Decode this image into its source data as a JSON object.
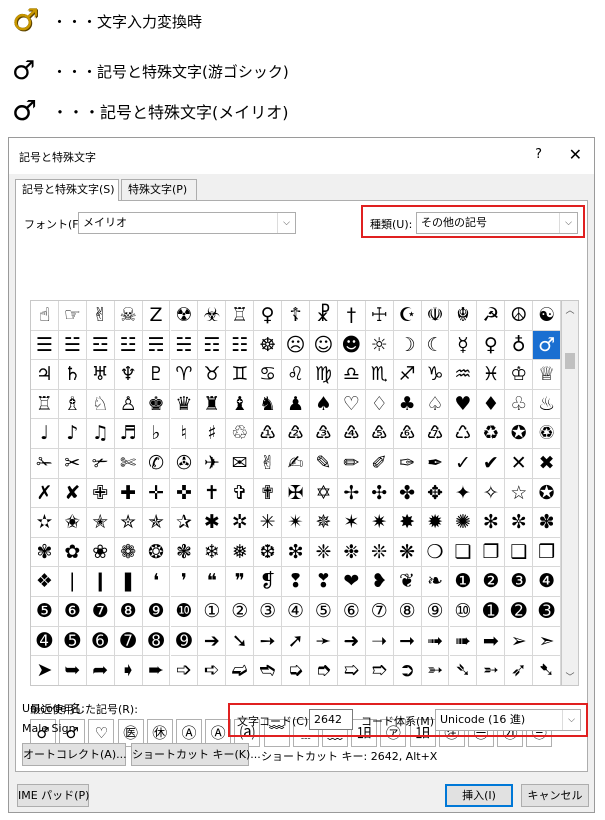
{
  "legend": [
    {
      "symbol": "♂",
      "text": "・・・文字入力変換時"
    },
    {
      "symbol": "♂",
      "text": "・・・記号と特殊文字(游ゴシック)"
    },
    {
      "symbol": "♂",
      "text": "・・・記号と特殊文字(メイリオ)"
    }
  ],
  "dialog": {
    "title": "記号と特殊文字",
    "help": "?",
    "close": "✕",
    "tabs": [
      "記号と特殊文字(S)",
      "特殊文字(P)"
    ],
    "font_label": "フォント(F):",
    "font_value": "メイリオ",
    "kind_label": "種類(U):",
    "kind_value": "その他の記号",
    "symbols": [
      [
        "☝",
        "☞",
        "✌",
        "☠",
        "Z",
        "☢",
        "☣",
        "♖",
        "♀",
        "☦",
        "☧",
        "†",
        "☩",
        "☪",
        "☫",
        "☬",
        "☭",
        "☮",
        "☯"
      ],
      [
        "☰",
        "☱",
        "☲",
        "☳",
        "☴",
        "☵",
        "☶",
        "☷",
        "☸",
        "☹",
        "☺",
        "☻",
        "☼",
        "☽",
        "☾",
        "☿",
        "♀",
        "♁",
        "♂"
      ],
      [
        "♃",
        "♄",
        "♅",
        "♆",
        "♇",
        "♈",
        "♉",
        "♊",
        "♋",
        "♌",
        "♍",
        "♎",
        "♏",
        "♐",
        "♑",
        "♒",
        "♓",
        "♔",
        "♕"
      ],
      [
        "♖",
        "♗",
        "♘",
        "♙",
        "♚",
        "♛",
        "♜",
        "♝",
        "♞",
        "♟",
        "♠",
        "♡",
        "♢",
        "♣",
        "♤",
        "♥",
        "♦",
        "♧",
        "♨"
      ],
      [
        "♩",
        "♪",
        "♫",
        "♬",
        "♭",
        "♮",
        "♯",
        "♲",
        "♳",
        "♴",
        "♵",
        "♶",
        "♷",
        "♸",
        "♹",
        "♺",
        "♻",
        "✪",
        "♽"
      ],
      [
        "✁",
        "✂",
        "✃",
        "✄",
        "✆",
        "✇",
        "✈",
        "✉",
        "✌",
        "✍",
        "✎",
        "✏",
        "✐",
        "✑",
        "✒",
        "✓",
        "✔",
        "✕",
        "✖"
      ],
      [
        "✗",
        "✘",
        "✙",
        "✚",
        "✛",
        "✜",
        "✝",
        "✞",
        "✟",
        "✠",
        "✡",
        "✢",
        "✣",
        "✤",
        "✥",
        "✦",
        "✧",
        "☆",
        "✪"
      ],
      [
        "✫",
        "✬",
        "✭",
        "✮",
        "✯",
        "✰",
        "✱",
        "✲",
        "✳",
        "✴",
        "✵",
        "✶",
        "✷",
        "✸",
        "✹",
        "✺",
        "✻",
        "✼",
        "✽"
      ],
      [
        "✾",
        "✿",
        "❀",
        "❁",
        "❂",
        "❃",
        "❄",
        "❅",
        "❆",
        "❇",
        "❈",
        "❉",
        "❊",
        "❋",
        "❍",
        "❏",
        "❐",
        "❑",
        "❒"
      ],
      [
        "❖",
        "❘",
        "❙",
        "❚",
        "❛",
        "❜",
        "❝",
        "❞",
        "❡",
        "❢",
        "❣",
        "❤",
        "❥",
        "❦",
        "❧",
        "❶",
        "❷",
        "❸",
        "❹"
      ],
      [
        "❺",
        "❻",
        "❼",
        "❽",
        "❾",
        "❿",
        "①",
        "②",
        "③",
        "④",
        "⑤",
        "⑥",
        "⑦",
        "⑧",
        "⑨",
        "⑩",
        "➊",
        "➋",
        "➌"
      ],
      [
        "➍",
        "➎",
        "➏",
        "➐",
        "➑",
        "➒",
        "➔",
        "➘",
        "➙",
        "➚",
        "➛",
        "➜",
        "➝",
        "➞",
        "➟",
        "➠",
        "➡",
        "➢",
        "➣"
      ],
      [
        "➤",
        "➥",
        "➦",
        "➧",
        "➨",
        "➩",
        "➪",
        "➫",
        "➬",
        "➭",
        "➮",
        "➯",
        "➱",
        "➲",
        "➳",
        "➴",
        "➵",
        "➶",
        "➷"
      ]
    ],
    "recent_label": "最近使用した記号(R):",
    "recent": [
      "♂",
      "♂",
      "♡",
      "㊩",
      "㊡",
      "Ⓐ",
      "Ⓐ",
      "⒜",
      "﹌",
      "﹍",
      "﹏",
      "㏠",
      "㋐",
      "㏠",
      "㊟",
      "㊀",
      "㉑",
      "㊂"
    ],
    "unicode_name_label": "Unicode 名:",
    "unicode_name_value": "Male Sign",
    "code_label": "文字コード(C):",
    "code_value": "2642",
    "code_system_label": "コード体系(M):",
    "code_system_value": "Unicode (16 進)",
    "autocorrect_button": "オートコレクト(A)...",
    "shortcut_button": "ショートカット キー(K)...",
    "shortcut_text": "ショートカット キー: 2642, Alt+X",
    "ime_button": "IME パッド(P)",
    "insert_button": "挿入(I)",
    "cancel_button": "キャンセル"
  },
  "colors": {
    "highlight": "#e02020",
    "selection": "#1a6fd1",
    "legend_gold": "#c89700"
  }
}
